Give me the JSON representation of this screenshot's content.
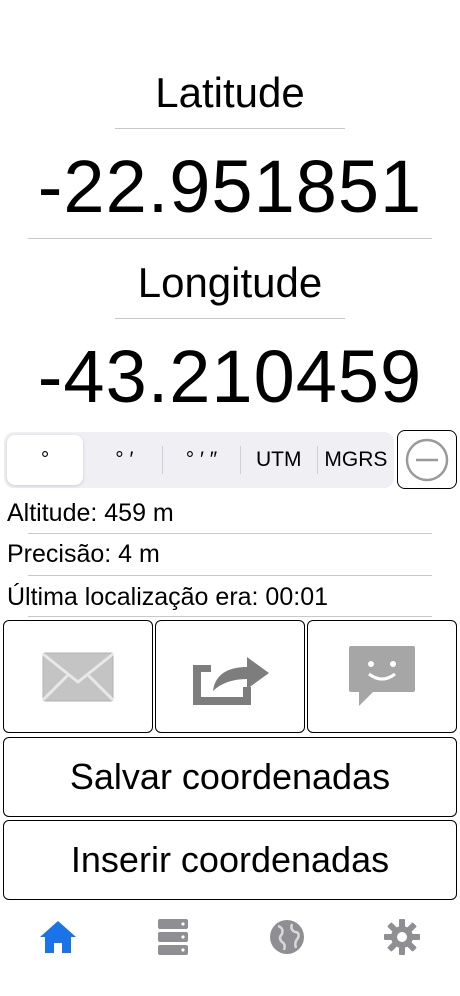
{
  "latitude": {
    "label": "Latitude",
    "value": "-22.951851"
  },
  "longitude": {
    "label": "Longitude",
    "value": "-43.210459"
  },
  "format_tabs": [
    {
      "label": "°",
      "selected": true
    },
    {
      "label": "° ′",
      "selected": false
    },
    {
      "label": "° ′ ″",
      "selected": false
    },
    {
      "label": "UTM",
      "selected": false
    },
    {
      "label": "MGRS",
      "selected": false
    }
  ],
  "info": {
    "altitude": "Altitude: 459 m",
    "precision": "Precisão: 4 m",
    "last_location": "Última localização era: 00:01"
  },
  "actions": {
    "mail_icon": "mail-icon",
    "share_icon": "share-icon",
    "message_icon": "message-icon"
  },
  "buttons": {
    "save": "Salvar coordenadas",
    "insert": "Inserir coordenadas"
  },
  "tabbar": [
    {
      "icon": "home-icon",
      "active": true
    },
    {
      "icon": "list-icon",
      "active": false
    },
    {
      "icon": "globe-icon",
      "active": false
    },
    {
      "icon": "gear-icon",
      "active": false
    }
  ],
  "colors": {
    "accent": "#1a73e8",
    "inactive": "#8e8e93"
  }
}
